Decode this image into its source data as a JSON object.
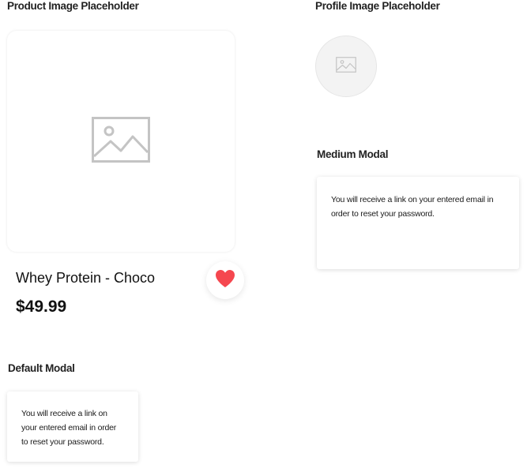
{
  "product_section": {
    "title": "Product Image Placeholder",
    "product": {
      "name": "Whey Protein - Choco",
      "price": "$49.99",
      "image_icon": "image-placeholder-icon",
      "favorite_icon": "heart-icon",
      "favorite_color": "#f5474f"
    }
  },
  "profile_section": {
    "title": "Profile Image Placeholder",
    "image_icon": "image-placeholder-icon"
  },
  "medium_modal": {
    "title": "Medium Modal",
    "message": "You will receive a link on your entered email in order to reset your password."
  },
  "default_modal": {
    "title": "Default Modal",
    "message": "You will receive a link on your entered email in order to reset your password."
  }
}
